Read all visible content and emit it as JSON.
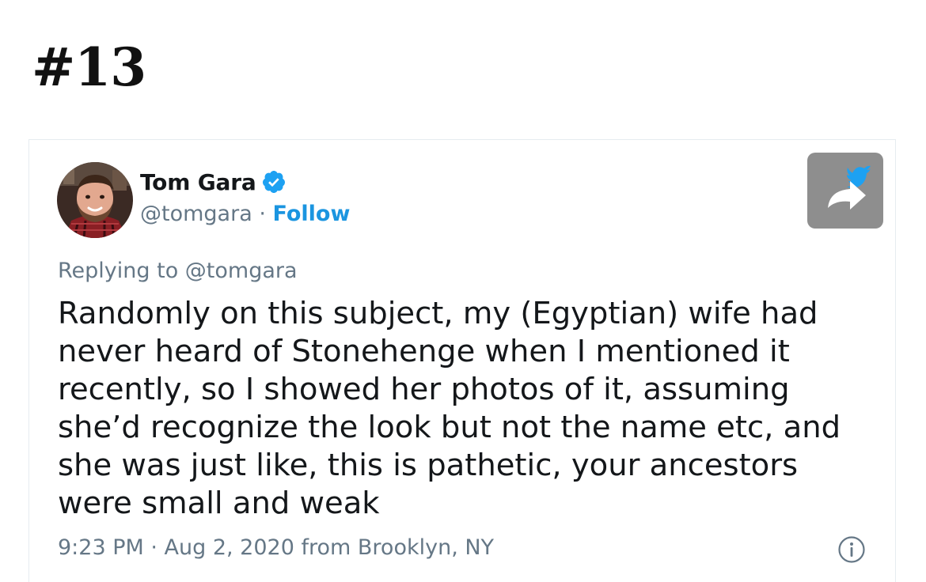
{
  "heading": "#13",
  "tweet": {
    "author_name": "Tom Gara",
    "handle": "@tomgara",
    "separator": " · ",
    "follow_label": "Follow",
    "replying_to": "Replying to @tomgara",
    "text": "Randomly on this subject, my (Egyptian) wife had\nnever heard of Stonehenge when I mentioned it\nrecently, so I showed her photos of it, assuming\nshe’d recognize the look but not the name etc, and\nshe was just like, this is pathetic, your ancestors\nwere small and weak",
    "meta": "9:23 PM · Aug 2, 2020 from Brooklyn, NY"
  },
  "icons": {
    "verified": "verified-badge-icon",
    "share": "twitter-share-icon",
    "info": "info-icon"
  },
  "colors": {
    "verified": "#1da1f2",
    "follow": "#1b95e0",
    "secondary_text": "#657786",
    "share_button": "#8e8e8e"
  }
}
